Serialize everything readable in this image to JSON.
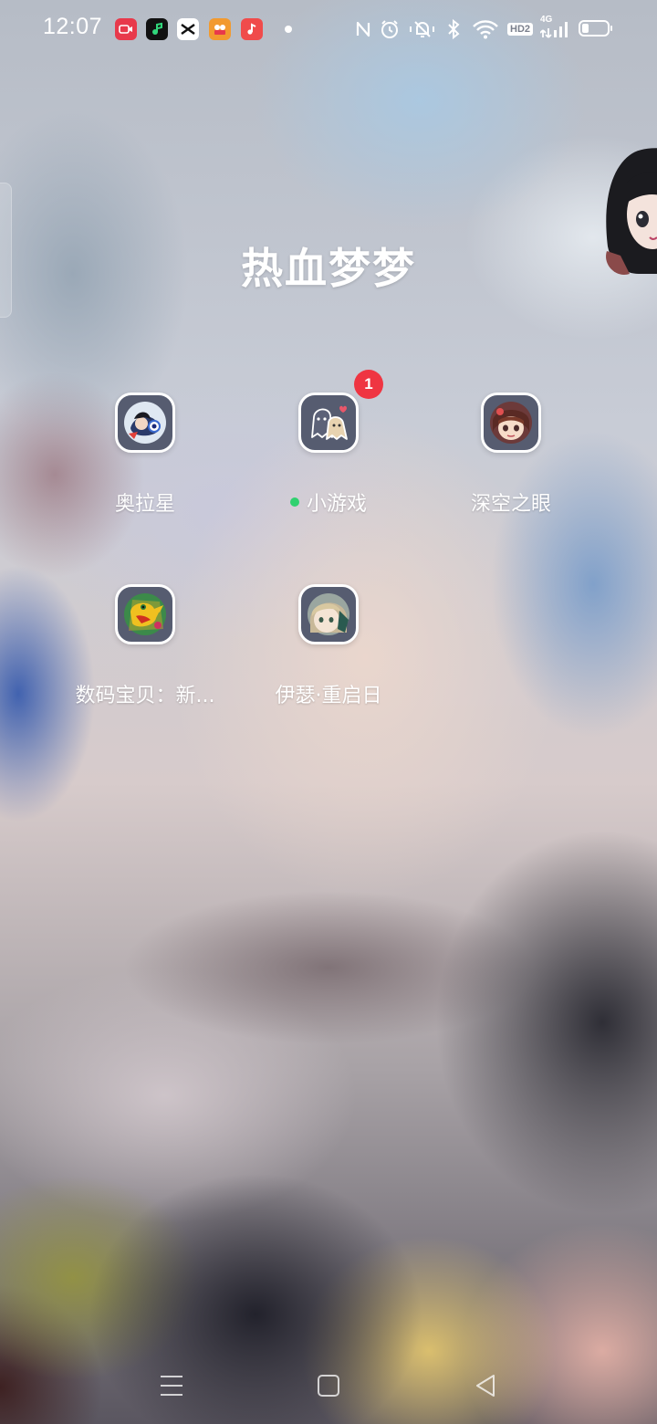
{
  "status_bar": {
    "time": "12:07",
    "notification_icons": [
      "video-recorder-icon",
      "music-note-green-icon",
      "capcut-icon",
      "camera-app-icon",
      "music-app-icon"
    ],
    "right_icons": [
      "nfc-icon",
      "alarm-icon",
      "silent-vibrate-icon",
      "bluetooth-icon",
      "wifi-icon",
      "hd-voice-icon",
      "cellular-4g-icon",
      "battery-icon"
    ],
    "hd_label": "HD2",
    "network_label": "4G",
    "battery_level": 0.25
  },
  "folder": {
    "title": "热血梦梦"
  },
  "apps": [
    {
      "label": "奥拉星",
      "icon": "aola-star-game-icon",
      "badge": null,
      "new_dot": false
    },
    {
      "label": "小游戏",
      "icon": "mini-games-ghost-icon",
      "badge": "1",
      "new_dot": true
    },
    {
      "label": "深空之眼",
      "icon": "deep-space-eye-game-icon",
      "badge": null,
      "new_dot": false
    },
    {
      "label": "数码宝贝：新...",
      "icon": "digimon-game-icon",
      "badge": null,
      "new_dot": false
    },
    {
      "label": "伊瑟·重启日",
      "icon": "ether-reboot-game-icon",
      "badge": null,
      "new_dot": false
    }
  ],
  "nav_bar": {
    "buttons": [
      "menu-icon",
      "home-icon",
      "back-icon"
    ]
  },
  "colors": {
    "badge_red": "#ef3542",
    "new_dot_green": "#2fd16f",
    "icon_bg": "#565c70"
  }
}
